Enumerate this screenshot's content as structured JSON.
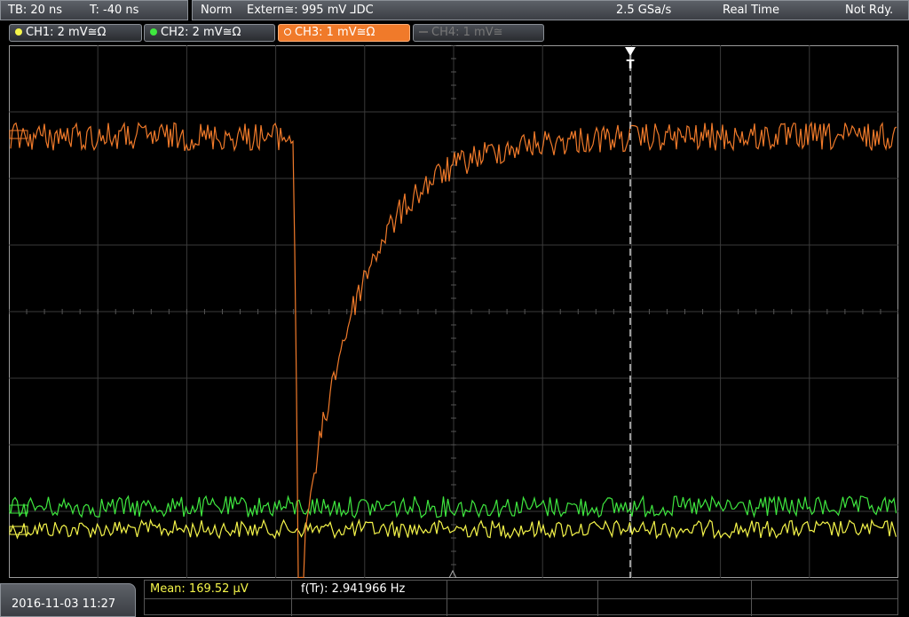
{
  "header": {
    "tb_label": "TB: 20 ns",
    "trigger_time": "T: -40 ns",
    "mode": "Norm",
    "trigger_source": "Extern≅: 995 mV ⅃DC",
    "sample_rate": "2.5 GSa/s",
    "acq_mode": "Real Time",
    "status": "Not Rdy."
  },
  "channels": [
    {
      "label": "CH1: 2 mV≅Ω",
      "color": "#f5f54a",
      "state": "on"
    },
    {
      "label": "CH2: 2 mV≅Ω",
      "color": "#3fe83f",
      "state": "on"
    },
    {
      "label": "CH3: 1 mV≅Ω",
      "color": "#f07a2a",
      "state": "selected"
    },
    {
      "label": "CH4: 1 mV≅",
      "color": "#777777",
      "state": "off"
    }
  ],
  "colors": {
    "ch1": "#f5f54a",
    "ch2": "#3fe83f",
    "ch3": "#f07a2a",
    "grid": "#3a3a3a",
    "frame": "#9a9a9a"
  },
  "trigger_marker": "T",
  "footer": {
    "datetime": "2016-11-03 11:27",
    "mean": "Mean: 169.52 µV",
    "freq": "f(Tr): 2.941966 Hz"
  }
}
